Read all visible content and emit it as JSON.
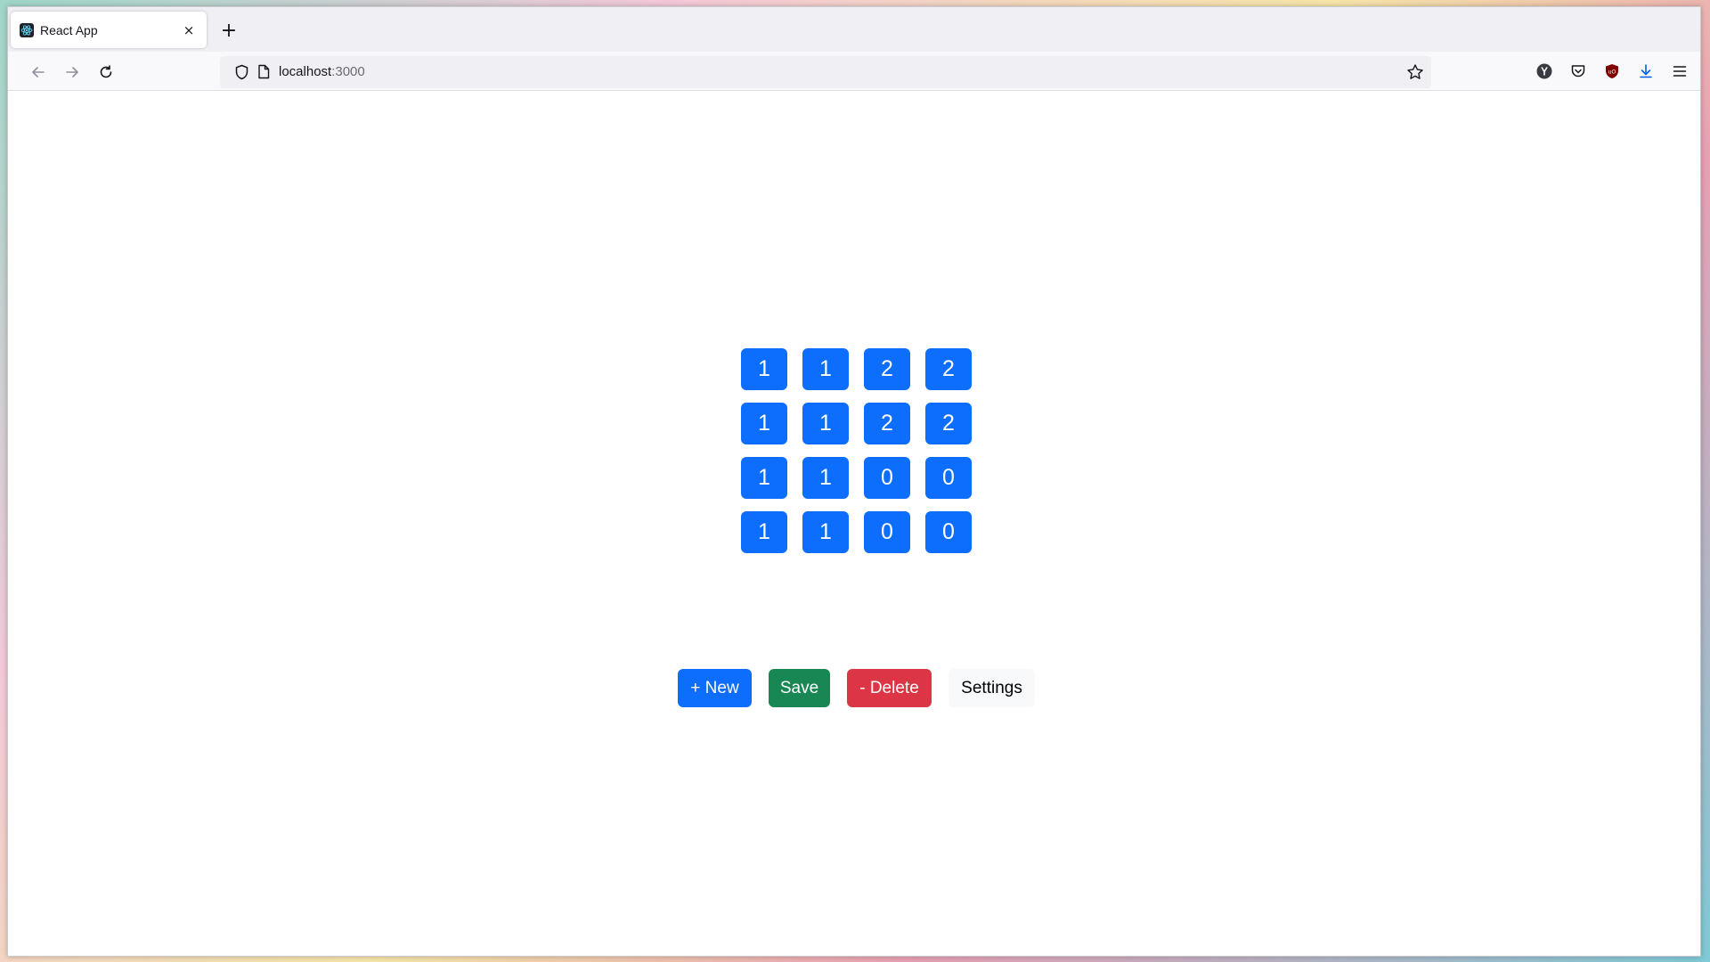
{
  "browser": {
    "tab_title": "React App",
    "tab_close": "×",
    "new_tab": "+",
    "url_host": "localhost",
    "url_port": ":3000"
  },
  "toolbar_icons": [
    "back-icon",
    "forward-icon",
    "reload-icon",
    "shield-icon",
    "page-icon",
    "bookmark-star-icon",
    "yandex-icon",
    "pocket-icon",
    "ublock-icon",
    "download-icon",
    "menu-icon"
  ],
  "grid": {
    "rows": [
      [
        "1",
        "1",
        "2",
        "2"
      ],
      [
        "1",
        "1",
        "2",
        "2"
      ],
      [
        "1",
        "1",
        "0",
        "0"
      ],
      [
        "1",
        "1",
        "0",
        "0"
      ]
    ]
  },
  "actions": {
    "new_label": "+ New",
    "save_label": "Save",
    "delete_label": "- Delete",
    "settings_label": "Settings"
  },
  "colors": {
    "primary": "#0d6efd",
    "success": "#198754",
    "danger": "#dc3545",
    "light": "#f8f9fa"
  }
}
